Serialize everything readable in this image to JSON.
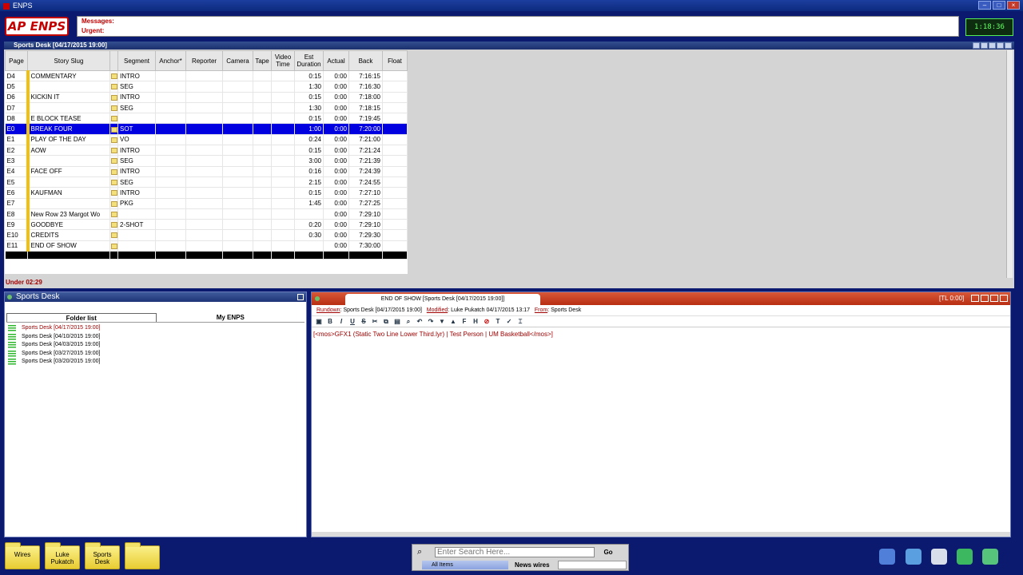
{
  "window": {
    "title": "ENPS"
  },
  "header": {
    "logo": "AP ENPS",
    "messages_label": "Messages:",
    "urgent_label": "Urgent:",
    "clock": "1:18:36"
  },
  "rundown": {
    "title": "Sports Desk [04/17/2015 19:00]",
    "columns": [
      "Page",
      "Story Slug",
      "",
      "Segment",
      "Anchor*",
      "Reporter",
      "Camera",
      "Tape",
      "Video Time",
      "Est Duration",
      "Actual",
      "Back",
      "Float"
    ],
    "rows": [
      {
        "page": "D4",
        "slug": "COMMENTARY",
        "segment": "INTRO",
        "est": "0:15",
        "actual": "0:00",
        "back": "7:16:15"
      },
      {
        "page": "D5",
        "slug": "",
        "segment": "SEG",
        "est": "1:30",
        "actual": "0:00",
        "back": "7:16:30"
      },
      {
        "page": "D6",
        "slug": "KICKIN IT",
        "segment": "INTRO",
        "est": "0:15",
        "actual": "0:00",
        "back": "7:18:00"
      },
      {
        "page": "D7",
        "slug": "",
        "segment": "SEG",
        "est": "1:30",
        "actual": "0:00",
        "back": "7:18:15"
      },
      {
        "page": "D8",
        "slug": "E BLOCK TEASE",
        "segment": "",
        "est": "0:15",
        "actual": "0:00",
        "back": "7:19:45"
      },
      {
        "page": "E0",
        "slug": "BREAK FOUR",
        "segment": "SOT",
        "est": "1:00",
        "actual": "0:00",
        "back": "7:20:00"
      },
      {
        "page": "E1",
        "slug": "PLAY OF THE DAY",
        "segment": "VO",
        "est": "0:24",
        "actual": "0:00",
        "back": "7:21:00"
      },
      {
        "page": "E2",
        "slug": "AOW",
        "segment": "INTRO",
        "est": "0:15",
        "actual": "0:00",
        "back": "7:21:24"
      },
      {
        "page": "E3",
        "slug": "",
        "segment": "SEG",
        "est": "3:00",
        "actual": "0:00",
        "back": "7:21:39"
      },
      {
        "page": "E4",
        "slug": "FACE OFF",
        "segment": "INTRO",
        "est": "0:16",
        "actual": "0:00",
        "back": "7:24:39"
      },
      {
        "page": "E5",
        "slug": "",
        "segment": "SEG",
        "est": "2:15",
        "actual": "0:00",
        "back": "7:24:55"
      },
      {
        "page": "E6",
        "slug": "KAUFMAN",
        "segment": "INTRO",
        "est": "0:15",
        "actual": "0:00",
        "back": "7:27:10"
      },
      {
        "page": "E7",
        "slug": "",
        "segment": "PKG",
        "est": "1:45",
        "actual": "0:00",
        "back": "7:27:25"
      },
      {
        "page": "E8",
        "slug": "New Row 23 Margot Wo",
        "segment": "",
        "est": "",
        "actual": "0:00",
        "back": "7:29:10"
      },
      {
        "page": "E9",
        "slug": "GOODBYE",
        "segment": "2-SHOT",
        "est": "0:20",
        "actual": "0:00",
        "back": "7:29:10"
      },
      {
        "page": "E10",
        "slug": "CREDITS",
        "segment": "",
        "est": "0:30",
        "actual": "0:00",
        "back": "7:29:30"
      },
      {
        "page": "E11",
        "slug": "END OF SHOW",
        "segment": "",
        "est": "",
        "actual": "0:00",
        "back": "7:30:00"
      }
    ],
    "selected_row": 5,
    "under_status": "Under 02:29"
  },
  "folders": {
    "title": "Sports Desk",
    "tabs": [
      "Folder list",
      "My ENPS"
    ],
    "items": [
      "Sports Desk [04/17/2015 19:00]",
      "Sports Desk [04/10/2015 19:00]",
      "Sports Desk [04/03/2015 19:00]",
      "Sports Desk [03/27/2015 19:00]",
      "Sports Desk [03/20/2015 19:00]"
    ]
  },
  "editor": {
    "tab_title": "END OF SHOW [Sports Desk [04/17/2015 19:00]]",
    "tl": "[TL 0:00]",
    "meta_rundown_label": "Rundown",
    "meta_rundown_value": "Sports Desk [04/17/2015 19:00]",
    "meta_modified_label": "Modified",
    "meta_modified_value": "Luke Pukatch  04/17/2015 13:17",
    "meta_from_label": "From",
    "meta_from_value": "Sports Desk",
    "body": "[<mos>GFX1 (Static Two Line Lower Third.lyr) | Test Person | UM Basketball</mos>]"
  },
  "taskbar": {
    "folders": [
      "Wires",
      "Luke Pukatch",
      "Sports Desk",
      ""
    ],
    "search_placeholder": "Enter Search Here...",
    "go_label": "Go",
    "all_items": "All Items",
    "news_wires": "News wires"
  },
  "colors": {
    "accent": "#0b1a6e",
    "selected_row": "#0000e0",
    "editor_title": "#c03a1c",
    "marker": "#f0c010"
  }
}
